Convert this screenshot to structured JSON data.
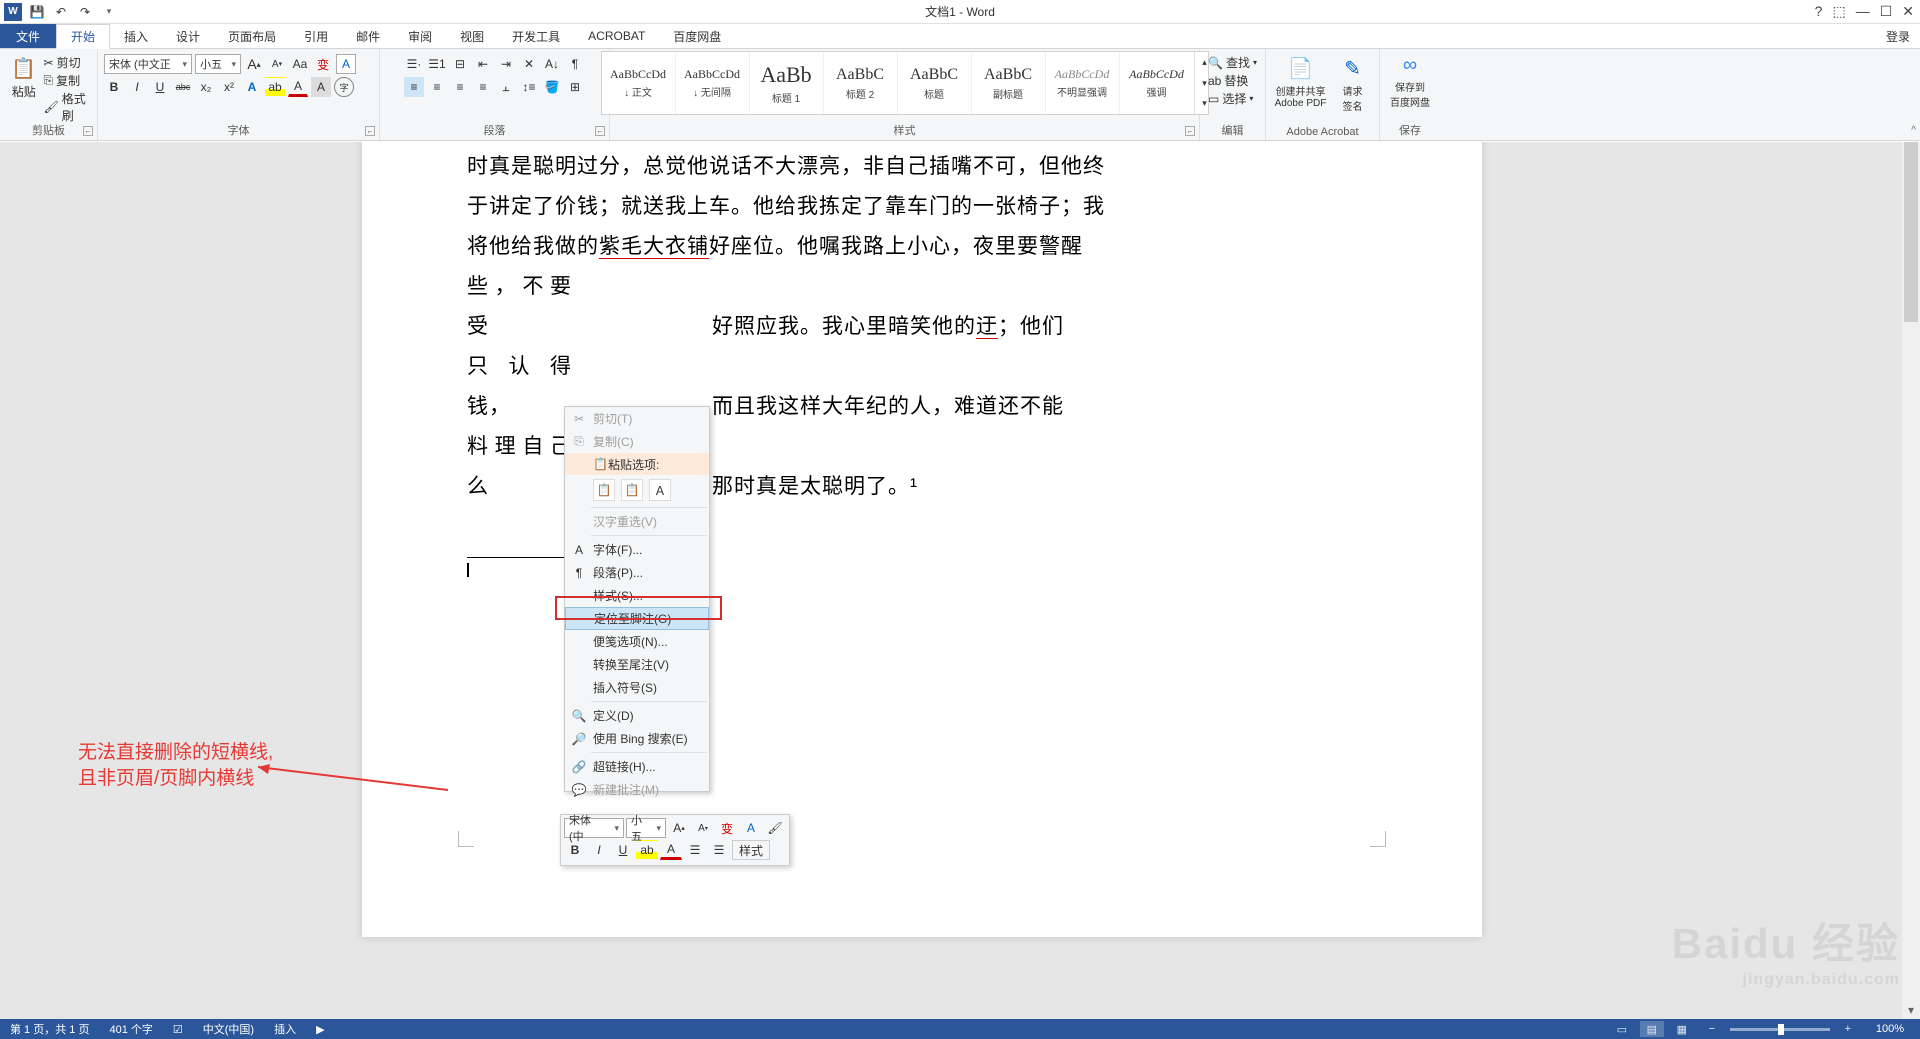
{
  "app": {
    "title": "文档1 - Word",
    "login": "登录"
  },
  "qat": {
    "save": "💾",
    "undo": "↶",
    "redo": "↷"
  },
  "tabs": [
    "文件",
    "开始",
    "插入",
    "设计",
    "页面布局",
    "引用",
    "邮件",
    "审阅",
    "视图",
    "开发工具",
    "ACROBAT",
    "百度网盘"
  ],
  "active_tab": 1,
  "ribbon": {
    "clipboard": {
      "label": "剪贴板",
      "paste": "粘贴",
      "cut": "剪切",
      "copy": "复制",
      "format_painter": "格式刷"
    },
    "font": {
      "label": "字体",
      "family": "宋体 (中文正",
      "size": "小五",
      "grow": "A",
      "shrink": "A",
      "case": "Aa",
      "phonetic": "拼",
      "clear": "A",
      "charborder": "A",
      "bold": "B",
      "italic": "I",
      "underline": "U",
      "strike": "abc",
      "sub": "x₂",
      "sup": "x²",
      "effects": "A",
      "highlight": "ab",
      "fontcolor": "A",
      "charshade": "A",
      "enclose": "字"
    },
    "paragraph": {
      "label": "段落"
    },
    "styles": {
      "label": "样式",
      "items": [
        {
          "preview": "AaBbCcDd",
          "name": "↓ 正文"
        },
        {
          "preview": "AaBbCcDd",
          "name": "↓ 无间隔"
        },
        {
          "preview": "AaBb",
          "name": "标题 1",
          "big": true
        },
        {
          "preview": "AaBbC",
          "name": "标题 2"
        },
        {
          "preview": "AaBbC",
          "name": "标题"
        },
        {
          "preview": "AaBbC",
          "name": "副标题"
        },
        {
          "preview": "AaBbCcDd",
          "name": "不明显强调",
          "italic": true
        },
        {
          "preview": "AaBbCcDd",
          "name": "强调",
          "italic": true
        }
      ]
    },
    "editing": {
      "label": "编辑",
      "find": "查找",
      "replace": "替换",
      "select": "选择"
    },
    "acrobat": {
      "label": "Adobe Acrobat",
      "create": "创建并共享",
      "create2": "Adobe PDF",
      "sign": "请求",
      "sign2": "签名"
    },
    "baidu": {
      "label": "保存",
      "save": "保存到",
      "save2": "百度网盘"
    }
  },
  "document": {
    "lines": [
      "时真是聪明过分，总觉他说话不大漂亮，非自己插嘴不可，但他终",
      "于讲定了价钱；就送我上车。他给我拣定了靠车门的一张椅子；我",
      "将他给我做的紫毛大衣铺好座位。他嘱我路上小心，夜里要警醒",
      "些，不要受",
      "好照应我。我心里暗笑他的迂；他们",
      "只认得钱，",
      "而且我这样大年纪的人，难道还不能",
      "料理自己么",
      "那时真是太聪明了。¹"
    ]
  },
  "context_menu": {
    "cut": "剪切(T)",
    "copy": "复制(C)",
    "paste_label": "粘贴选项:",
    "reconvert": "汉字重选(V)",
    "font": "字体(F)...",
    "paragraph": "段落(P)...",
    "styles": "样式(S)...",
    "goto_footnote": "定位至脚注(G)",
    "note_options": "便笺选项(N)...",
    "convert_endnote": "转换至尾注(V)",
    "insert_symbol": "插入符号(S)",
    "define": "定义(D)",
    "bing_search": "使用 Bing 搜索(E)",
    "hyperlink": "超链接(H)...",
    "new_comment": "新建批注(M)"
  },
  "minitb": {
    "font": "宋体 (中",
    "size": "小五",
    "styles": "样式"
  },
  "annotation": {
    "line1": "无法直接删除的短横线,",
    "line2": "且非页眉/页脚内横线"
  },
  "status": {
    "page": "第 1 页，共 1 页",
    "words": "401 个字",
    "lang": "中文(中国)",
    "insert": "插入",
    "zoom": "100%"
  },
  "watermark": {
    "main": "Baidu 经验",
    "sub": "jingyan.baidu.com"
  }
}
